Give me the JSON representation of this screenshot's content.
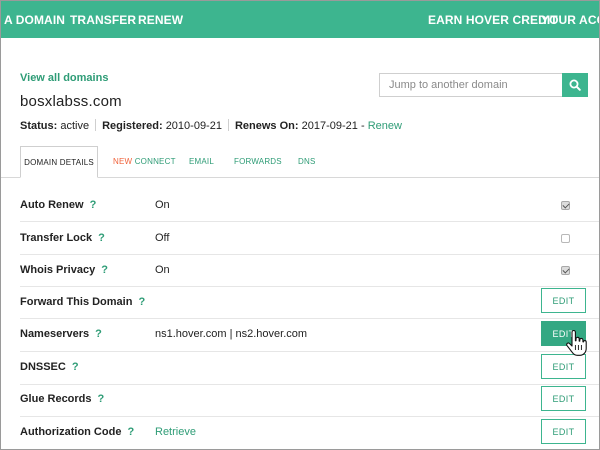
{
  "nav": {
    "domain": "A DOMAIN",
    "transfer": "TRANSFER",
    "renew": "RENEW",
    "earn_credit": "EARN HOVER CREDIT",
    "account": "YOUR ACCOUNT"
  },
  "view_all_link": "View all domains",
  "search": {
    "placeholder": "Jump to another domain",
    "icon": "search-icon"
  },
  "domain": {
    "name": "bosxlabss.com",
    "status_label": "Status:",
    "status_value": "active",
    "registered_label": "Registered:",
    "registered_value": "2010-09-21",
    "renews_label": "Renews On:",
    "renews_value": "2017-09-21",
    "renews_dash": "-",
    "renew_link": "Renew"
  },
  "tabs": {
    "details": "DOMAIN DETAILS",
    "connect_new": "NEW",
    "connect": "CONNECT",
    "email": "EMAIL",
    "forwards": "FORWARDS",
    "dns": "DNS"
  },
  "rows": {
    "auto_renew": {
      "label": "Auto Renew",
      "value": "On",
      "checked": true
    },
    "transfer_lock": {
      "label": "Transfer Lock",
      "value": "Off",
      "checked": false
    },
    "whois_privacy": {
      "label": "Whois Privacy",
      "value": "On",
      "checked": true
    },
    "forward": {
      "label": "Forward This Domain",
      "button": "EDIT"
    },
    "nameservers": {
      "label": "Nameservers",
      "value": "ns1.hover.com | ns2.hover.com",
      "button": "EDIT"
    },
    "dnssec": {
      "label": "DNSSEC",
      "button": "EDIT"
    },
    "glue": {
      "label": "Glue Records",
      "button": "EDIT"
    },
    "auth_code": {
      "label": "Authorization Code",
      "value": "Retrieve",
      "button": "EDIT"
    }
  },
  "help_mark": "?",
  "colors": {
    "brand": "#3db58f",
    "link": "#2e9c76",
    "new_badge": "#f0623a"
  }
}
